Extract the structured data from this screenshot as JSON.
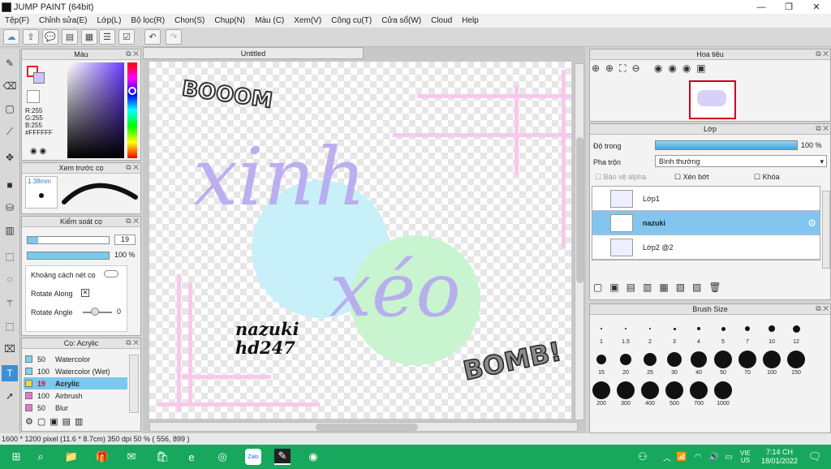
{
  "window": {
    "title": "JUMP PAINT (64bit)"
  },
  "menu": [
    "Tệp(F)",
    "Chỉnh sửa(E)",
    "Lớp(L)",
    "Bộ lọc(R)",
    "Chọn(S)",
    "Chụp(N)",
    "Màu (C)",
    "Xem(V)",
    "Công cụ(T)",
    "Cửa sổ(W)",
    "Cloud",
    "Help"
  ],
  "color_panel": {
    "title": "Màu",
    "r": "R:255",
    "g": "G:255",
    "b": "B:255",
    "hex": "#FFFFFF"
  },
  "preview_panel": {
    "title": "Xem trước cọ",
    "size": "1.38mm"
  },
  "brush_control": {
    "title": "Kiểm soát cọ",
    "size_value": "19",
    "opacity_value": "100 %",
    "size_fill": 0.19,
    "opacity_fill": 1.0,
    "spacing_label": "Khoảng cách nét cọ",
    "rotate_along_label": "Rotate Along",
    "rotate_angle_label": "Rotate Angle",
    "rotate_angle_value": "0"
  },
  "brush_list": {
    "title": "Cọ: Acrylic",
    "items": [
      {
        "size": "50",
        "name": "Watercolor",
        "color": "#7dd3ee"
      },
      {
        "size": "100",
        "name": "Watercolor (Wet)",
        "color": "#7dd3ee"
      },
      {
        "size": "19",
        "name": "Acrylic",
        "color": "#e8d84a"
      },
      {
        "size": "100",
        "name": "Airbrush",
        "color": "#e07ad0"
      },
      {
        "size": "50",
        "name": "Blur",
        "color": "#e07ad0"
      }
    ]
  },
  "document": {
    "tab": "Untitled"
  },
  "canvas_text": {
    "boom": "BOOOM",
    "main1": "xinh",
    "main2": "xéo",
    "sig1": "nazuki",
    "sig2": "hd247",
    "bomb": "BOMB!"
  },
  "navigator": {
    "title": "Hoa tiêu"
  },
  "layer_panel": {
    "title": "Lớp",
    "opacity_label": "Độ trong",
    "opacity_value": "100 %",
    "opacity_fill": 1.0,
    "blend_label": "Pha trộn",
    "blend_value": "Bình thường",
    "protect_alpha": "Bảo vệ alpha",
    "clip": "Xén bớt",
    "lock": "Khóa",
    "layers": [
      {
        "name": "Lớp1",
        "selected": false
      },
      {
        "name": "nazuki",
        "selected": true
      },
      {
        "name": "Lớp2 @2",
        "selected": false
      }
    ]
  },
  "brush_size": {
    "title": "Brush Size",
    "sizes": [
      "1",
      "1.5",
      "2",
      "3",
      "4",
      "5",
      "7",
      "10",
      "12",
      "15",
      "20",
      "25",
      "30",
      "40",
      "50",
      "70",
      "100",
      "150",
      "200",
      "300",
      "400",
      "500",
      "700",
      "1000"
    ]
  },
  "status": {
    "text": "1600 * 1200 pixel   (11.6 * 8.7cm)   350 dpi   50 %   ( 556, 899 )"
  },
  "taskbar": {
    "lang1": "VIE",
    "lang2": "US",
    "time": "7:14 CH",
    "date": "18/01/2022"
  },
  "colors": {
    "accent": "#3b8fd6",
    "taskbar": "#17a85e",
    "selected_layer": "#82c6ef"
  }
}
